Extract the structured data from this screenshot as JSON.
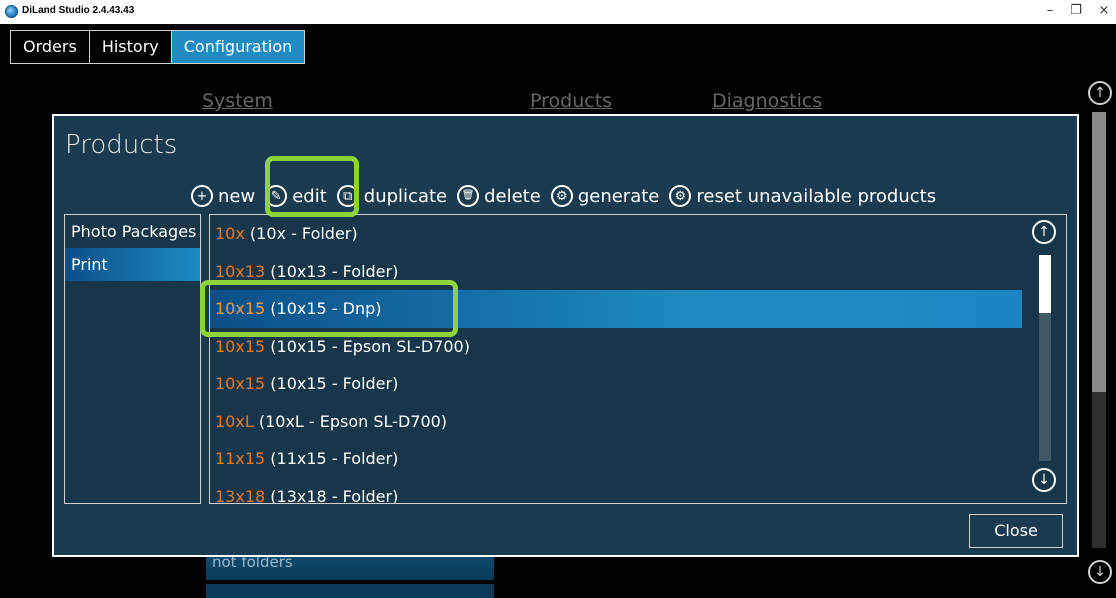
{
  "window": {
    "title": "DiLand Studio 2.4.43.43",
    "minimize": "–",
    "maximize": "❐",
    "close": "×"
  },
  "tabs": [
    {
      "label": "Orders",
      "active": false
    },
    {
      "label": "History",
      "active": false
    },
    {
      "label": "Configuration",
      "active": true
    }
  ],
  "background": {
    "nav": [
      "System",
      "Products",
      "Diagnostics"
    ],
    "folders_label": "not folders",
    "scroll_up": "↑",
    "scroll_down": "↓"
  },
  "dialog": {
    "title": "Products",
    "toolbar": [
      {
        "icon": "plus-icon",
        "glyph": "+",
        "label": "new"
      },
      {
        "icon": "pencil-icon",
        "glyph": "✎",
        "label": "edit"
      },
      {
        "icon": "duplicate-icon",
        "glyph": "⧉",
        "label": "duplicate"
      },
      {
        "icon": "trash-icon",
        "glyph": "🗑",
        "label": "delete"
      },
      {
        "icon": "gear-icon",
        "glyph": "⚙",
        "label": "generate"
      },
      {
        "icon": "gear-icon",
        "glyph": "⚙",
        "label": "reset unavailable products"
      }
    ],
    "categories": [
      {
        "label": "Photo Packages",
        "active": false
      },
      {
        "label": "Print",
        "active": true
      }
    ],
    "products": [
      {
        "code": "10x",
        "desc": " (10x - Folder)",
        "selected": false
      },
      {
        "code": "10x13",
        "desc": " (10x13 - Folder)",
        "selected": false
      },
      {
        "code": "10x15",
        "desc": " (10x15 - Dnp)",
        "selected": true
      },
      {
        "code": "10x15",
        "desc": " (10x15 - Epson SL-D700)",
        "selected": false
      },
      {
        "code": "10x15",
        "desc": " (10x15 - Folder)",
        "selected": false
      },
      {
        "code": "10xL",
        "desc": " (10xL - Epson SL-D700)",
        "selected": false
      },
      {
        "code": "11x15",
        "desc": " (11x15 - Folder)",
        "selected": false
      },
      {
        "code": "13x18",
        "desc": " (13x18 - Folder)",
        "selected": false
      }
    ],
    "scroll_up": "↑",
    "scroll_down": "↓",
    "close_label": "Close"
  },
  "colors": {
    "accent": "#1e8bc3",
    "product_code": "#e07b2a",
    "highlight": "#8cd43a",
    "dialog_bg": "#1a3b4f"
  }
}
